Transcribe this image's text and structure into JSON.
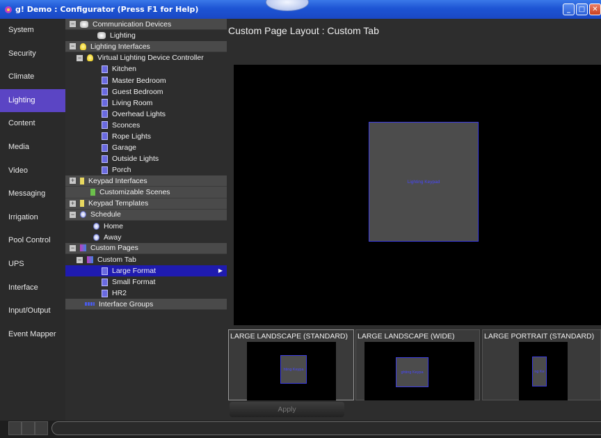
{
  "window": {
    "title": "g! Demo : Configurator   (Press F1 for Help)",
    "buttons": [
      "minimize-icon",
      "maximize-icon",
      "close-icon"
    ]
  },
  "nav": {
    "items": [
      "System",
      "Security",
      "Climate",
      "Lighting",
      "Content",
      "Media",
      "Video",
      "Messaging",
      "Irrigation",
      "Pool Control",
      "UPS",
      "Interface",
      "Input/Output",
      "Event Mapper"
    ],
    "active": "Lighting"
  },
  "tree": {
    "rows": [
      {
        "label": "Communication Devices",
        "type": "group",
        "expander": "−",
        "icon": "comm"
      },
      {
        "label": "Lighting",
        "type": "item",
        "indent": 40,
        "icon": "comm"
      },
      {
        "label": "Lighting Interfaces",
        "type": "group",
        "expander": "−",
        "icon": "bulb"
      },
      {
        "label": "Virtual Lighting Device Controller",
        "type": "item",
        "indent": 10,
        "expander": "−",
        "icon": "bulb"
      },
      {
        "label": "Kitchen",
        "type": "item",
        "indent": 46,
        "icon": "doc"
      },
      {
        "label": "Master Bedroom",
        "type": "item",
        "indent": 46,
        "icon": "doc"
      },
      {
        "label": "Guest Bedroom",
        "type": "item",
        "indent": 46,
        "icon": "doc"
      },
      {
        "label": "Living Room",
        "type": "item",
        "indent": 46,
        "icon": "doc"
      },
      {
        "label": "Overhead Lights",
        "type": "item",
        "indent": 46,
        "icon": "doc"
      },
      {
        "label": "Sconces",
        "type": "item",
        "indent": 46,
        "icon": "doc"
      },
      {
        "label": "Rope Lights",
        "type": "item",
        "indent": 46,
        "icon": "doc"
      },
      {
        "label": "Garage",
        "type": "item",
        "indent": 46,
        "icon": "doc"
      },
      {
        "label": "Outside Lights",
        "type": "item",
        "indent": 46,
        "icon": "doc"
      },
      {
        "label": "Porch",
        "type": "item",
        "indent": 46,
        "icon": "doc"
      },
      {
        "label": "Keypad Interfaces",
        "type": "group",
        "expander": "+",
        "icon": "kp"
      },
      {
        "label": "Customizable Scenes",
        "type": "group",
        "indent": 30,
        "icon": "scene"
      },
      {
        "label": "Keypad Templates",
        "type": "group",
        "expander": "+",
        "icon": "kp"
      },
      {
        "label": "Schedule",
        "type": "group",
        "expander": "−",
        "icon": "clock"
      },
      {
        "label": "Home",
        "type": "item",
        "indent": 34,
        "icon": "clock"
      },
      {
        "label": "Away",
        "type": "item",
        "indent": 34,
        "icon": "clock"
      },
      {
        "label": "Custom Pages",
        "type": "group",
        "expander": "−",
        "icon": "pages"
      },
      {
        "label": "Custom Tab",
        "type": "item",
        "indent": 10,
        "expander": "−",
        "icon": "pages"
      },
      {
        "label": "Large Format",
        "type": "item",
        "indent": 46,
        "icon": "doc",
        "selected": true
      },
      {
        "label": "Small Format",
        "type": "item",
        "indent": 46,
        "icon": "doc"
      },
      {
        "label": "HR2",
        "type": "item",
        "indent": 46,
        "icon": "doc"
      },
      {
        "label": "Interface Groups",
        "type": "group",
        "indent": 22,
        "icon": "groups"
      }
    ]
  },
  "main": {
    "title": "Custom Page Layout : Custom Tab",
    "keypad_label": "Lighting Keypad",
    "thumbs": [
      {
        "label": "LARGE LANDSCAPE (STANDARD)",
        "keypad_text": "hting Keypa",
        "active": true
      },
      {
        "label": "LARGE LANDSCAPE (WIDE)",
        "keypad_text": "ghting Keypa",
        "active": false
      },
      {
        "label": "LARGE PORTRAIT (STANDARD)",
        "keypad_text": "ng Ke",
        "active": false
      }
    ],
    "apply_label": "Apply"
  },
  "colors": {
    "accent": "#5b45c4",
    "selection": "#1f1bb0",
    "keypad_text": "#4848ff"
  }
}
